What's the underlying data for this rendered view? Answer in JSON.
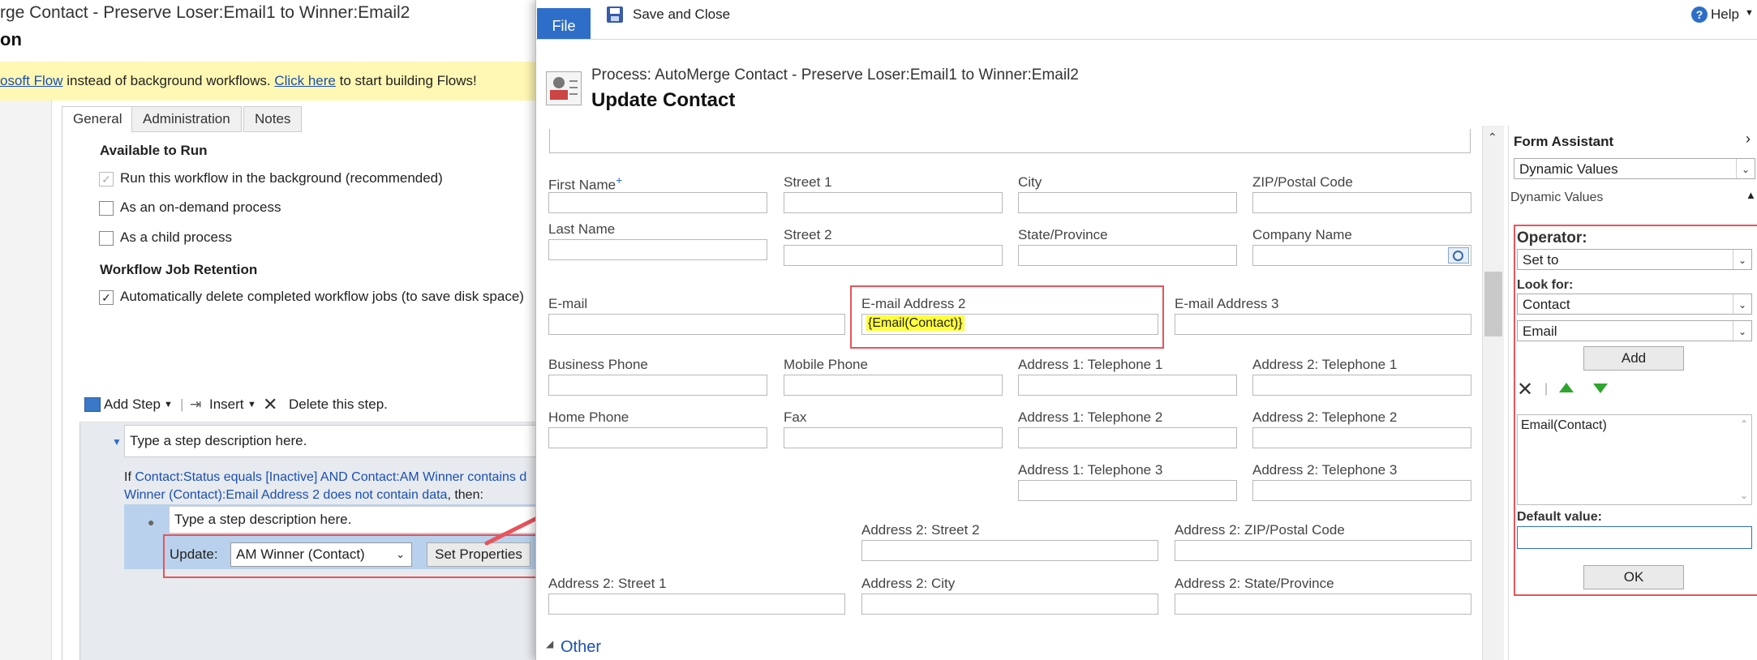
{
  "background": {
    "title": "rge Contact - Preserve Loser:Email1 to Winner:Email2",
    "subtitle": "on",
    "banner": {
      "link1": "osoft Flow",
      "text1": " instead of background workflows. ",
      "link2": "Click here",
      "text2": " to start building Flows!"
    },
    "tabs": [
      "General",
      "Administration",
      "Notes"
    ],
    "available_heading": "Available to Run",
    "options": [
      {
        "label": "Run this workflow in the background (recommended)",
        "checked": true,
        "disabled": true
      },
      {
        "label": "As an on-demand process",
        "checked": false,
        "disabled": false
      },
      {
        "label": "As a child process",
        "checked": false,
        "disabled": false
      }
    ],
    "retention_heading": "Workflow Job Retention",
    "retention_option": {
      "label": "Automatically delete completed workflow jobs (to save disk space)",
      "checked": true
    },
    "toolbar": {
      "add_step": "Add Step",
      "insert": "Insert",
      "delete_step": "Delete this step."
    },
    "step_description": "Type a step description here.",
    "condition": {
      "if_word": "If ",
      "line1_blue": "Contact:Status equals [Inactive] AND Contact:AM Winner contains d",
      "line2_blue": "Winner (Contact):Email Address 2 does not contain data",
      "line2_tail": ", then:"
    },
    "inner_step_description": "Type a step description here.",
    "update_label": "Update:",
    "update_target": "AM Winner (Contact)",
    "set_properties": "Set Properties"
  },
  "dialog": {
    "file_tab": "File",
    "save_close": "Save and Close",
    "help": "Help",
    "process_label": "Process: AutoMerge Contact - Preserve Loser:Email1 to Winner:Email2",
    "title": "Update Contact",
    "fields": {
      "first_name": "First Name",
      "required_mark": "+",
      "street1": "Street 1",
      "city": "City",
      "zip": "ZIP/Postal Code",
      "last_name": "Last Name",
      "street2": "Street 2",
      "state": "State/Province",
      "company": "Company Name",
      "email": "E-mail",
      "email2": "E-mail Address 2",
      "email2_value": "{Email(Contact)}",
      "email3": "E-mail Address 3",
      "business_phone": "Business Phone",
      "mobile_phone": "Mobile Phone",
      "a1_tel1": "Address 1: Telephone 1",
      "a2_tel1": "Address 2: Telephone 1",
      "home_phone": "Home Phone",
      "fax": "Fax",
      "a1_tel2": "Address 1: Telephone 2",
      "a2_tel2": "Address 2: Telephone 2",
      "a1_tel3": "Address 1: Telephone 3",
      "a2_tel3": "Address 2: Telephone 3",
      "a2_street2": "Address 2: Street 2",
      "a2_zip": "Address 2: ZIP/Postal Code",
      "a2_street1": "Address 2: Street 1",
      "a2_city": "Address 2: City",
      "a2_state": "Address 2: State/Province"
    },
    "section_other": "Other",
    "form_assistant": {
      "title": "Form Assistant",
      "mode_select": "Dynamic Values",
      "section": "Dynamic Values",
      "operator_label": "Operator:",
      "operator_value": "Set to",
      "look_for_label": "Look for:",
      "look_for_entity": "Contact",
      "look_for_field": "Email",
      "add_button": "Add",
      "list_items": [
        "Email(Contact)"
      ],
      "default_label": "Default value:",
      "default_value": "",
      "ok_button": "OK"
    }
  },
  "colors": {
    "accent_blue": "#2e6ec8",
    "highlight_red": "#e8545b",
    "highlight_yellow": "#ffff3c",
    "banner_yellow": "#fff7b3",
    "green_arrow": "#2ea62e"
  }
}
